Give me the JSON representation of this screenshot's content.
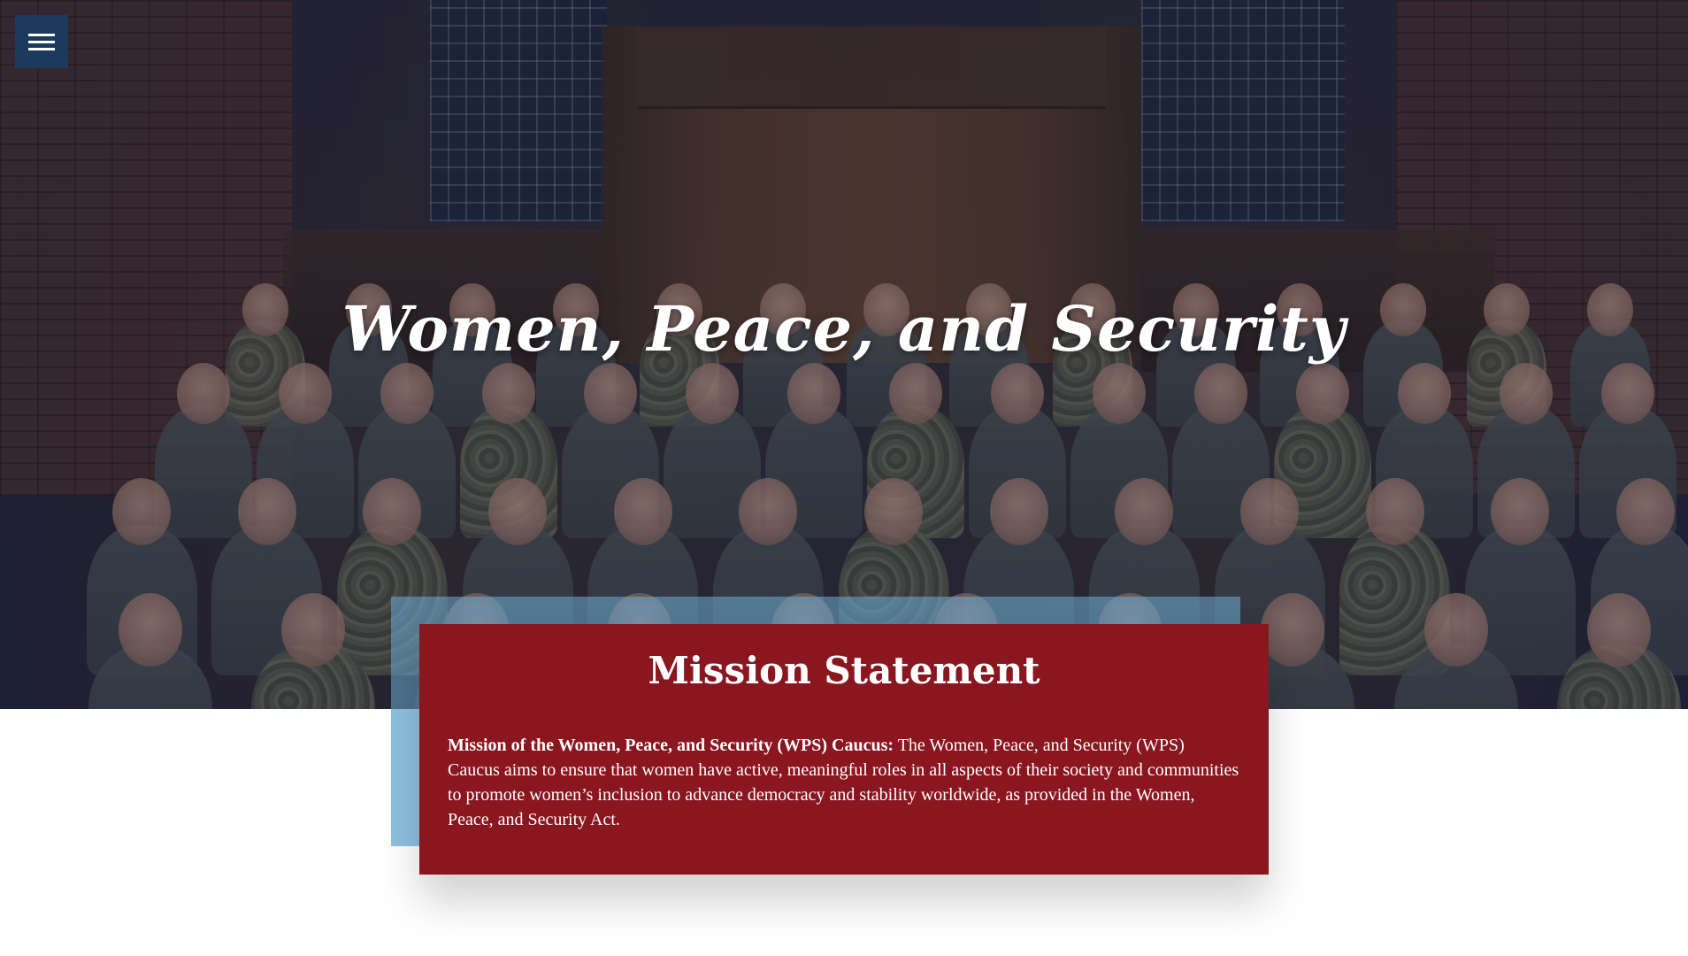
{
  "nav": {
    "menu_icon": "hamburger-menu-icon"
  },
  "hero": {
    "title": "Women, Peace, and Security",
    "image_alt": "Group photo of women service members in uniform"
  },
  "mission": {
    "heading": "Mission Statement",
    "lead": "Mission of the Women, Peace, and Security (WPS) Caucus:",
    "body": " The Women, Peace, and Security (WPS) Caucus aims to ensure that women have active, meaningful roles in all aspects of their society and communities to promote women’s inclusion to advance democracy and stability worldwide, as provided in the Women, Peace, and Security Act."
  },
  "colors": {
    "menu_button_bg": "#1b3a5c",
    "card_bg": "#8a1620",
    "accent_blue": "#8ec1e0"
  }
}
